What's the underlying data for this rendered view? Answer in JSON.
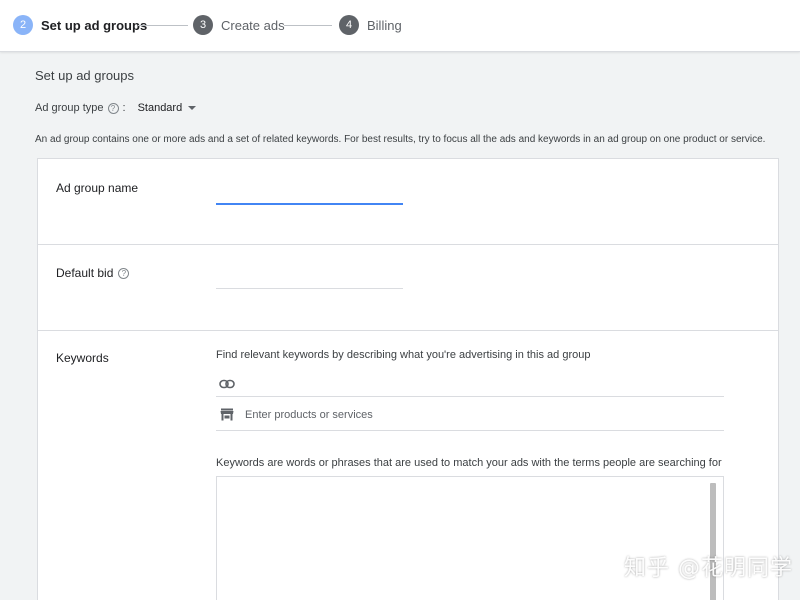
{
  "stepper": {
    "steps": [
      {
        "number": "2",
        "label": "Set up ad groups",
        "state": "active"
      },
      {
        "number": "3",
        "label": "Create ads",
        "state": "inactive"
      },
      {
        "number": "4",
        "label": "Billing",
        "state": "inactive"
      }
    ]
  },
  "page": {
    "title": "Set up ad groups",
    "ad_group_type_label": "Ad group type",
    "ad_group_type_colon": ":",
    "ad_group_type_value": "Standard",
    "intro": "An ad group contains one or more ads and a set of related keywords. For best results, try to focus all the ads and keywords in an ad group on one product or service."
  },
  "form": {
    "ad_group_name_label": "Ad group name",
    "ad_group_name_value": "",
    "default_bid_label": "Default bid",
    "default_bid_value": "",
    "keywords_label": "Keywords",
    "keywords_find_text": "Find relevant keywords by describing what you're advertising in this ad group",
    "url_input_value": "",
    "products_placeholder": "Enter products or services",
    "keywords_description": "Keywords are words or phrases that are used to match your ads with the terms people are searching for",
    "keywords_textarea_value": ""
  },
  "icons": {
    "help": "help-circle-icon",
    "link": "link-icon",
    "store": "store-icon",
    "dropdown": "caret-down-icon"
  },
  "colors": {
    "accent": "#4285f4",
    "active_step": "#8ab4f8",
    "inactive_step": "#5f6368",
    "background": "#f1f3f4"
  },
  "watermark": "知乎 @花明同学"
}
